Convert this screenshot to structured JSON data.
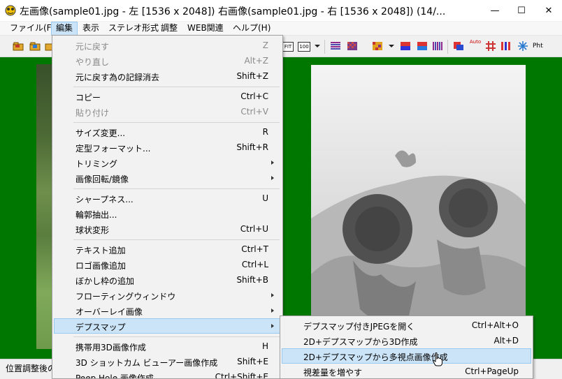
{
  "window": {
    "title": "左画像(sample01.jpg - 左 [1536 x 2048]) 右画像(sample01.jpg - 右 [1536 x 2048]) (14/...",
    "minimize_glyph": "—",
    "maximize_glyph": "☐",
    "close_glyph": "✕"
  },
  "menubar": {
    "items": [
      "ファイル(F)",
      "編集",
      "表示",
      "ステレオ形式",
      "調整",
      "WEB関連",
      "ヘルプ(H)"
    ],
    "active": "編集"
  },
  "toolbar": {
    "fit_label": "FIT",
    "zoom_label": "100",
    "auto_label": "Auto",
    "pht_label": "Pht"
  },
  "statusbar": {
    "text": "位置調整後の"
  },
  "edit_menu": {
    "items": [
      {
        "label": "元に戻す",
        "shortcut": "Z",
        "disabled": true
      },
      {
        "label": "やり直し",
        "shortcut": "Alt+Z",
        "disabled": true
      },
      {
        "label": "元に戻す為の記録消去",
        "shortcut": "Shift+Z"
      },
      {
        "label": "コピー",
        "shortcut": "Ctrl+C"
      },
      {
        "label": "貼り付け",
        "shortcut": "Ctrl+V",
        "disabled": true
      },
      {
        "label": "サイズ変更...",
        "shortcut": "R"
      },
      {
        "label": "定型フォーマット...",
        "shortcut": "Shift+R"
      },
      {
        "label": "トリミング",
        "submenu": true
      },
      {
        "label": "画像回転/鏡像",
        "submenu": true
      },
      {
        "label": "シャープネス...",
        "shortcut": "U"
      },
      {
        "label": "輪郭抽出...",
        "shortcut": ""
      },
      {
        "label": "球状変形",
        "shortcut": "Ctrl+U"
      },
      {
        "label": "テキスト追加",
        "shortcut": "Ctrl+T"
      },
      {
        "label": "ロゴ画像追加",
        "shortcut": "Ctrl+L"
      },
      {
        "label": "ぼかし枠の追加",
        "shortcut": "Shift+B"
      },
      {
        "label": "フローティングウィンドウ",
        "submenu": true
      },
      {
        "label": "オーバーレイ画像",
        "submenu": true
      },
      {
        "label": "デプスマップ",
        "submenu": true,
        "highlighted": true
      },
      {
        "label": "携帯用3D画像作成",
        "shortcut": "H"
      },
      {
        "label": "3D ショットカム ビューアー画像作成",
        "shortcut": "Shift+E"
      },
      {
        "label": "Peep Hole 画像作成",
        "shortcut": "Ctrl+Shift+E"
      }
    ]
  },
  "depth_submenu": {
    "items": [
      {
        "label": "デプスマップ付きJPEGを開く",
        "shortcut": "Ctrl+Alt+O"
      },
      {
        "label": "2D+デプスマップから3D作成",
        "shortcut": "Alt+D"
      },
      {
        "label": "2D+デプスマップから多視点画像作成",
        "shortcut": "",
        "highlighted": true
      },
      {
        "label": "視差量を増やす",
        "shortcut": "Ctrl+PageUp"
      }
    ]
  },
  "colors": {
    "workspace_bg": "#007800",
    "menu_highlight": "#cce4f7",
    "menu_highlight_border": "#99c9ef",
    "menu_bg": "#f2f2f2"
  }
}
